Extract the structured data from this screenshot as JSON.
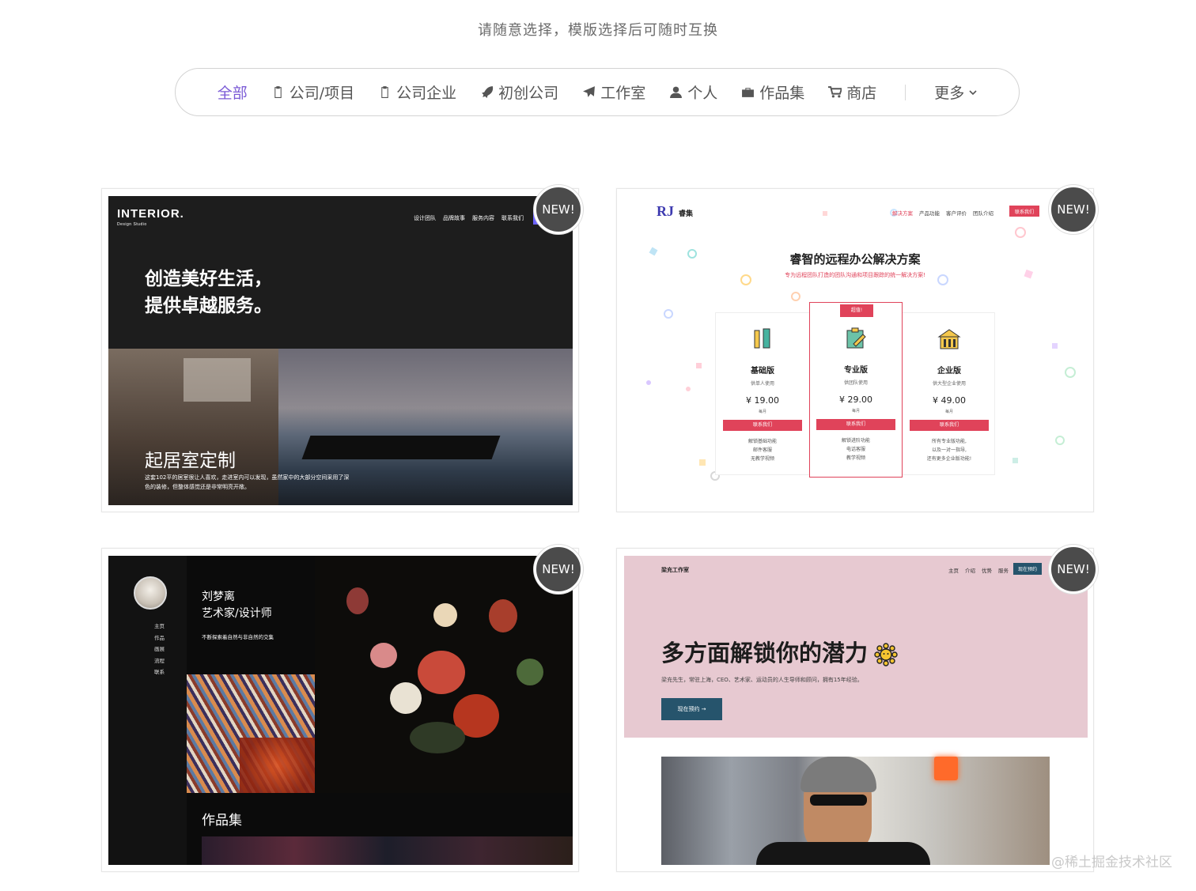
{
  "subtitle": "请随意选择，模版选择后可随时互换",
  "filters": [
    {
      "label": "全部",
      "icon": "none",
      "active": true
    },
    {
      "label": "公司/项目",
      "icon": "clipboard-icon"
    },
    {
      "label": "公司企业",
      "icon": "clipboard-icon"
    },
    {
      "label": "初创公司",
      "icon": "rocket-icon"
    },
    {
      "label": "工作室",
      "icon": "paper-plane-icon"
    },
    {
      "label": "个人",
      "icon": "user-icon"
    },
    {
      "label": "作品集",
      "icon": "briefcase-icon"
    },
    {
      "label": "商店",
      "icon": "cart-icon"
    }
  ],
  "more_label": "更多",
  "badge_text": "NEW!",
  "accent_color": "#7b5bd6",
  "cards": {
    "interior": {
      "logo": "INTERIOR.",
      "logo_sub": "Design Studio",
      "nav": [
        "设计团队",
        "品牌故事",
        "服务内容",
        "联系我们"
      ],
      "title_line1": "创造美好生活，",
      "title_line2": "提供卓越服务。",
      "section_title": "起居室定制",
      "desc": "这套102平的居室很让人喜欢，走进室内可以发现，虽然家中的大部分空间采用了深色的装修，但整体感觉还是非常明亮开敞。"
    },
    "ruizhi": {
      "logo": "RJ",
      "name": "睿集",
      "nav": [
        "解决方案",
        "产品功能",
        "客户评价",
        "团队介绍"
      ],
      "nav_button": "联系我们",
      "title": "睿智的远程办公解决方案",
      "subtitle": "专为远程团队打造的团队沟通和项目跟踪的统一解决方案!",
      "plans": [
        {
          "name": "基础版",
          "desc": "供单人使用",
          "price": "¥ 19.00",
          "per": "每月",
          "cta": "联系我们",
          "features": [
            "解锁基础功能",
            "邮件客服",
            "无教学视频"
          ]
        },
        {
          "name": "专业版",
          "desc": "供团队使用",
          "price": "¥ 29.00",
          "per": "每月",
          "cta": "联系我们",
          "features": [
            "解锁进阶功能",
            "电话客服",
            "教学视频"
          ],
          "tag": "超值!"
        },
        {
          "name": "企业版",
          "desc": "供大型企业使用",
          "price": "¥ 49.00",
          "per": "每月",
          "cta": "联系我们",
          "features": [
            "所有专业版功能,",
            "以及一对一指导,",
            "还有更多企业版功能!"
          ]
        }
      ]
    },
    "artist": {
      "name_line1": "刘梦离",
      "name_line2": "艺术家/设计师",
      "tagline": "不断探索着自然与非自然的交集",
      "menu": [
        "主页",
        "作品",
        "画展",
        "流程",
        "联系"
      ],
      "section_label": "作品集"
    },
    "studio": {
      "brand": "梁充工作室",
      "nav": [
        "主页",
        "介绍",
        "优势",
        "服务"
      ],
      "nav_button": "现在预约",
      "title": "多方面解锁你的潜力",
      "desc": "梁充先生，常驻上海，CEO、艺术家、运动员的人生导师和顾问，拥有15年经验。",
      "cta": "现在预约 →"
    }
  },
  "watermark": "@稀土掘金技术社区"
}
